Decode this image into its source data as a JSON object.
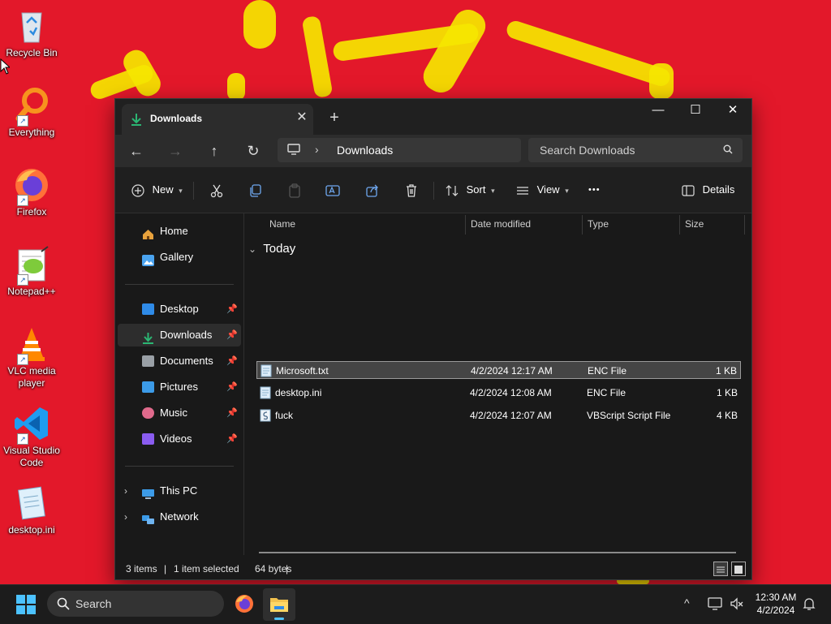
{
  "desktop": {
    "icons": [
      {
        "label": "Recycle Bin",
        "icon": "recycle-bin-icon"
      },
      {
        "label": "Everything",
        "icon": "everything-search-icon"
      },
      {
        "label": "Firefox",
        "icon": "firefox-icon"
      },
      {
        "label": "Notepad++",
        "icon": "notepadpp-icon"
      },
      {
        "label": "VLC media player",
        "icon": "vlc-icon"
      },
      {
        "label": "Visual Studio Code",
        "icon": "vscode-icon"
      },
      {
        "label": "desktop.ini",
        "icon": "notepad-file-icon"
      }
    ]
  },
  "window": {
    "tab_title": "Downloads",
    "tab_close": "✕",
    "new_tab": "+",
    "minimize": "—",
    "maximize": "☐",
    "close": "✕"
  },
  "nav": {
    "back": "←",
    "forward": "→",
    "up": "↑",
    "refresh": "↻",
    "breadcrumb_sep": "›",
    "breadcrumb": "Downloads",
    "search_placeholder": "Search Downloads"
  },
  "toolbar": {
    "new_label": "New",
    "sort_label": "Sort",
    "view_label": "View",
    "more_label": "•••",
    "details_label": "Details"
  },
  "sidebar": {
    "home": "Home",
    "gallery": "Gallery",
    "pinned": [
      {
        "label": "Desktop",
        "color": "#2f8be8"
      },
      {
        "label": "Downloads",
        "color": "#2bb673"
      },
      {
        "label": "Documents",
        "color": "#9aa0a6"
      },
      {
        "label": "Pictures",
        "color": "#3c9be8"
      },
      {
        "label": "Music",
        "color": "#e06a8c"
      },
      {
        "label": "Videos",
        "color": "#8a5cf0"
      }
    ],
    "pin_glyph": "📌",
    "this_pc": "This PC",
    "network": "Network",
    "expand_glyph": "›"
  },
  "columns": {
    "name": "Name",
    "date": "Date modified",
    "type": "Type",
    "size": "Size"
  },
  "group": {
    "chevron": "⌄",
    "label": "Today"
  },
  "files": [
    {
      "name": "Microsoft.txt",
      "date": "4/2/2024 12:17 AM",
      "type": "ENC File",
      "size": "1 KB"
    },
    {
      "name": "desktop.ini",
      "date": "4/2/2024 12:08 AM",
      "type": "ENC File",
      "size": "1 KB"
    },
    {
      "name": "fuck",
      "date": "4/2/2024 12:07 AM",
      "type": "VBScript Script File",
      "size": "4 KB"
    }
  ],
  "status": {
    "items": "3 items",
    "sep": "|",
    "selected": "1 item selected",
    "size": "64 bytes"
  },
  "taskbar": {
    "search_placeholder": "Search",
    "time": "12:30 AM",
    "date": "4/2/2024",
    "chevron": "^"
  }
}
